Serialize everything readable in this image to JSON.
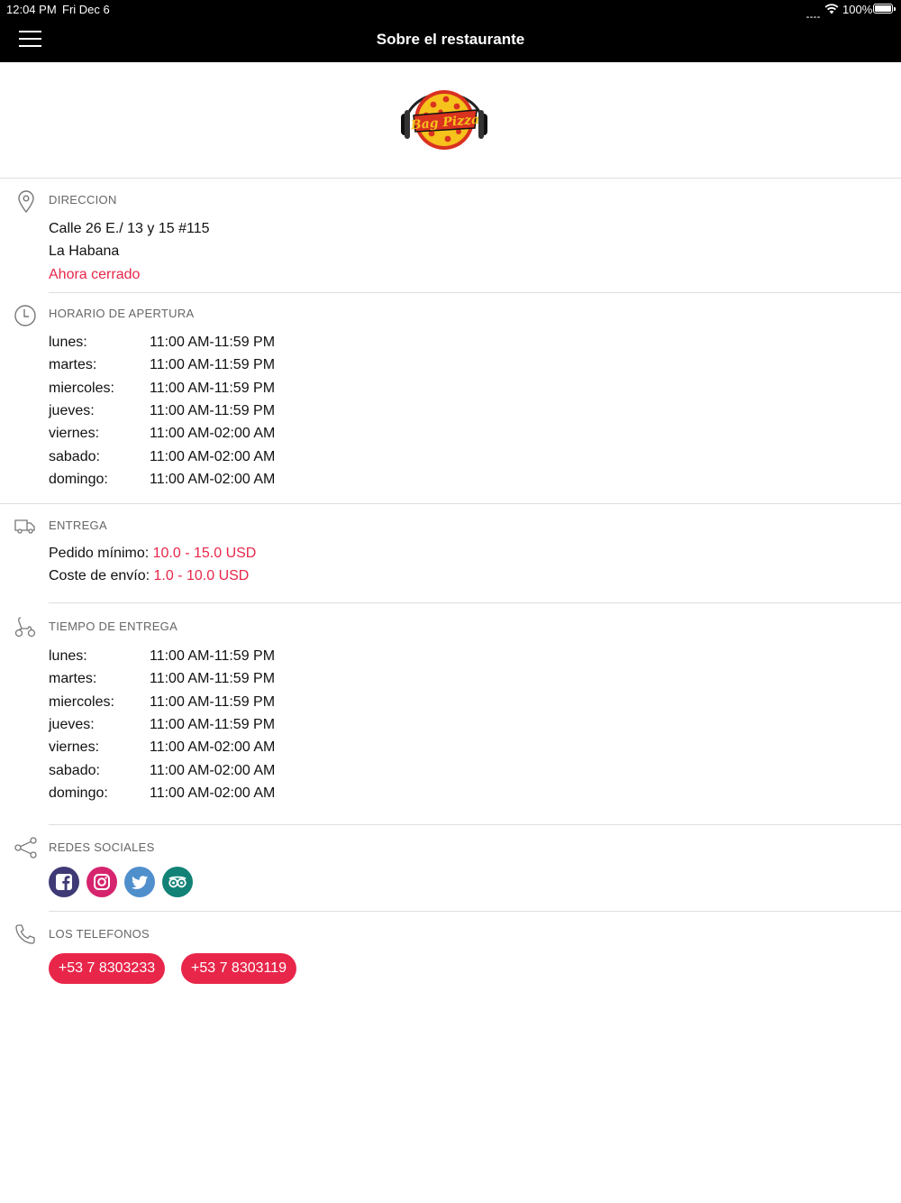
{
  "status_bar": {
    "time": "12:04 PM",
    "date": "Fri Dec 6",
    "battery": "100%"
  },
  "header": {
    "title": "Sobre el restaurante",
    "menu_icon": "hamburger-icon"
  },
  "logo": {
    "text": "Bag Pizza",
    "icon": "pizza-logo"
  },
  "address": {
    "title": "DIRECCION",
    "icon": "location-pin-icon",
    "line1": "Calle 26 E./ 13 y 15 #115",
    "line2": "La Habana",
    "status": "Ahora cerrado"
  },
  "opening_hours": {
    "title": "HORARIO DE APERTURA",
    "icon": "clock-icon",
    "rows": [
      {
        "day": "lunes:",
        "hours": "11:00 AM-11:59 PM"
      },
      {
        "day": "martes:",
        "hours": "11:00 AM-11:59 PM"
      },
      {
        "day": "miercoles:",
        "hours": "11:00 AM-11:59 PM"
      },
      {
        "day": "jueves:",
        "hours": "11:00 AM-11:59 PM"
      },
      {
        "day": "viernes:",
        "hours": "11:00 AM-02:00 AM"
      },
      {
        "day": "sabado:",
        "hours": "11:00 AM-02:00 AM"
      },
      {
        "day": "domingo:",
        "hours": "11:00 AM-02:00 AM"
      }
    ]
  },
  "delivery": {
    "title": "ENTREGA",
    "icon": "delivery-truck-icon",
    "min_order_label": "Pedido mínimo:",
    "min_order_value": "10.0 - 15.0 USD",
    "shipping_label": "Coste de envío:",
    "shipping_value": "1.0 - 10.0 USD"
  },
  "delivery_time": {
    "title": "TIEMPO DE ENTREGA",
    "icon": "scooter-icon",
    "rows": [
      {
        "day": "lunes:",
        "hours": "11:00 AM-11:59 PM"
      },
      {
        "day": "martes:",
        "hours": "11:00 AM-11:59 PM"
      },
      {
        "day": "miercoles:",
        "hours": "11:00 AM-11:59 PM"
      },
      {
        "day": "jueves:",
        "hours": "11:00 AM-11:59 PM"
      },
      {
        "day": "viernes:",
        "hours": "11:00 AM-02:00 AM"
      },
      {
        "day": "sabado:",
        "hours": "11:00 AM-02:00 AM"
      },
      {
        "day": "domingo:",
        "hours": "11:00 AM-02:00 AM"
      }
    ]
  },
  "social": {
    "title": "REDES SOCIALES",
    "icon": "share-icon",
    "links": [
      {
        "name": "facebook-icon",
        "color": "#3b5998"
      },
      {
        "name": "instagram-icon",
        "color": "#d6246e"
      },
      {
        "name": "twitter-icon",
        "color": "#55acee"
      },
      {
        "name": "tripadvisor-icon",
        "color": "#00a680"
      }
    ]
  },
  "phones": {
    "title": "LOS TELEFONOS",
    "icon": "phone-icon",
    "numbers": [
      "+53 7 8303233",
      "+53 7 8303119"
    ]
  },
  "colors": {
    "accent": "#e8264a",
    "header_bg": "#000000"
  }
}
